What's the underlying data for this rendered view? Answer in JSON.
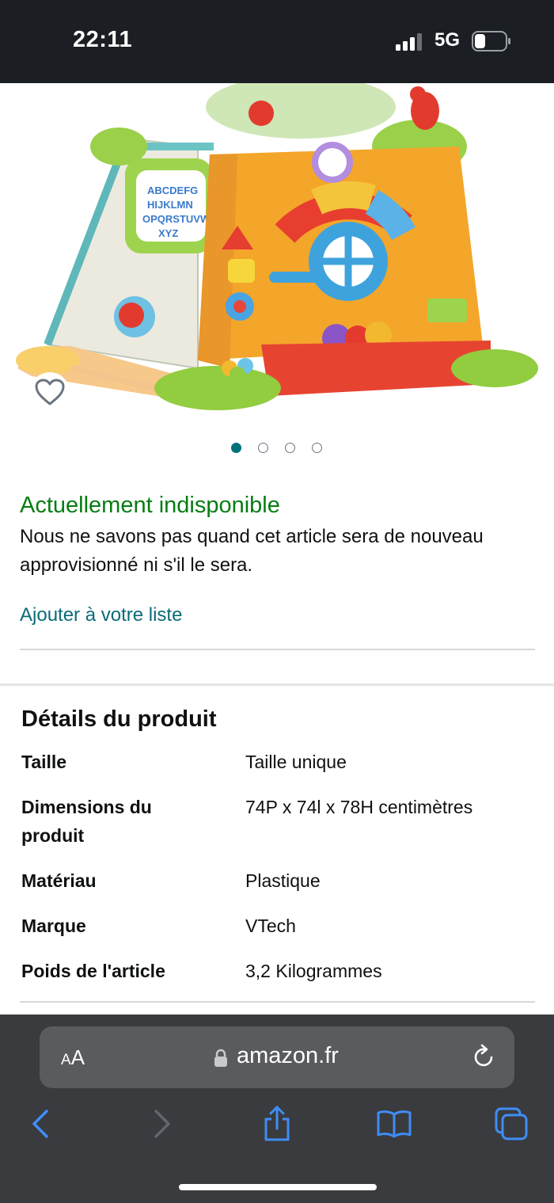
{
  "status_bar": {
    "time": "22:11",
    "network": "5G",
    "icons": [
      "signal-bars-icon",
      "battery-icon"
    ]
  },
  "product": {
    "image_alt": "VTech tree house play toy",
    "carousel": {
      "total": 4,
      "active_index": 0
    },
    "favorite_icon": "heart-outline-icon"
  },
  "availability": {
    "status": "Actuellement indisponible",
    "message": "Nous ne savons pas quand cet article sera de nouveau approvisionné ni s'il le sera.",
    "add_to_list": "Ajouter à votre liste"
  },
  "details": {
    "title": "Détails du produit",
    "rows": [
      {
        "label": "Taille",
        "value": "Taille unique"
      },
      {
        "label": "Dimensions du produit",
        "value": "74P x 74l x 78H centimètres"
      },
      {
        "label": "Matériau",
        "value": "Plastique"
      },
      {
        "label": "Marque",
        "value": "VTech"
      },
      {
        "label": "Poids de l'article",
        "value": "3,2 Kilogrammes"
      }
    ]
  },
  "browser": {
    "text_size_label_large": "A",
    "text_size_label_small": "A",
    "url": "amazon.fr",
    "toolbar_icons": [
      "back-icon",
      "forward-icon",
      "share-icon",
      "bookmarks-icon",
      "tabs-icon"
    ]
  },
  "colors": {
    "status_green": "#067d12",
    "link_teal": "#0b6b78",
    "active_dot": "#00727a",
    "browser_bg": "#3a3b3e",
    "ios_blue": "#3e8ef7"
  }
}
